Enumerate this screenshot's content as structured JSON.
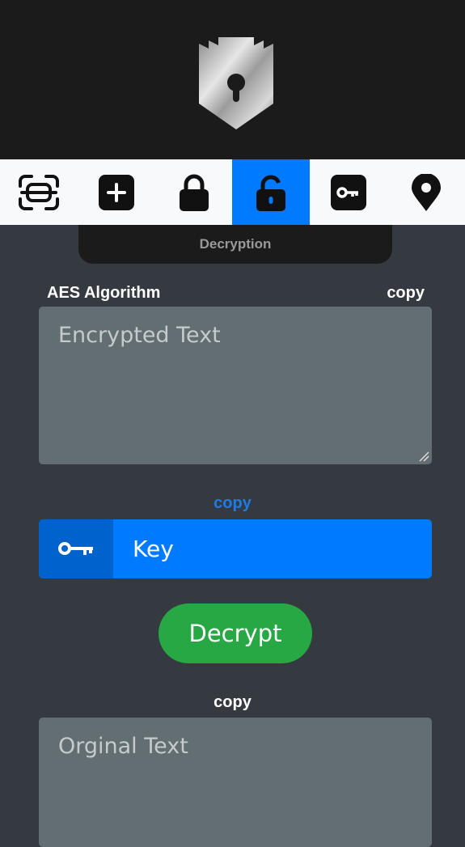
{
  "app": {
    "logo_icon": "castle-lock-icon"
  },
  "nav": {
    "items": [
      {
        "icon": "scan-icon",
        "active": false
      },
      {
        "icon": "plus-square-icon",
        "active": false
      },
      {
        "icon": "lock-icon",
        "active": false
      },
      {
        "icon": "unlock-icon",
        "active": true
      },
      {
        "icon": "key-square-icon",
        "active": false
      },
      {
        "icon": "map-pin-icon",
        "active": false
      }
    ],
    "active_color": "#007bff"
  },
  "section": {
    "title": "Decryption"
  },
  "encrypted": {
    "title": "AES Algorithm",
    "copy_label": "copy",
    "placeholder": "Encrypted Text",
    "value": ""
  },
  "key": {
    "copy_label": "copy",
    "copy_color": "#1e7be6",
    "placeholder": "Key",
    "value": "",
    "icon": "key-icon"
  },
  "decrypt_button": {
    "label": "Decrypt",
    "color": "#28a745"
  },
  "original": {
    "copy_label": "copy",
    "placeholder": "Orginal Text",
    "value": ""
  }
}
